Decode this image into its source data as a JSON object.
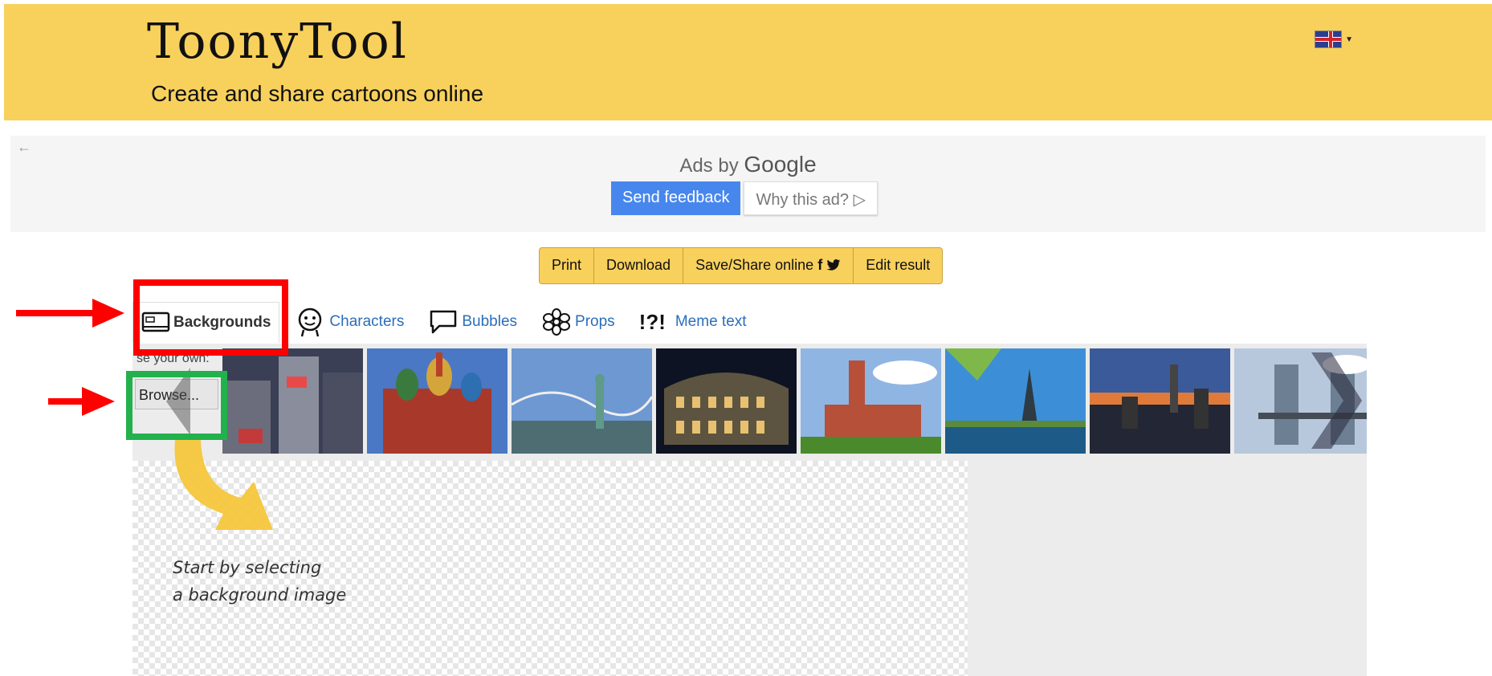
{
  "header": {
    "logo_text": "ToonyTool",
    "tagline": "Create and share cartoons online",
    "language_flag": "uk-flag-icon"
  },
  "ad": {
    "ads_by_prefix": "Ads by",
    "ads_by_brand": "Google",
    "send_feedback": "Send feedback",
    "why_this_ad": "Why this ad?",
    "why_icon": "▷"
  },
  "toolbar": {
    "print": "Print",
    "download": "Download",
    "save_share": "Save/Share online",
    "save_share_icons": "f 🐦",
    "edit_result": "Edit result"
  },
  "tabs": [
    {
      "label": "Backgrounds",
      "icon": "picture-frame-icon",
      "active": true
    },
    {
      "label": "Characters",
      "icon": "character-face-icon",
      "active": false
    },
    {
      "label": "Bubbles",
      "icon": "speech-bubble-icon",
      "active": false
    },
    {
      "label": "Props",
      "icon": "flower-icon",
      "active": false
    },
    {
      "label": "Meme text",
      "icon": "exclamation-icon",
      "active": false
    }
  ],
  "tab_symbols": {
    "meme": "!?!"
  },
  "strip": {
    "own_label": "se your own:",
    "browse_label": "Browse..."
  },
  "thumbnails": [
    {
      "name": "shibuya-city",
      "colors": [
        "#2f3a5a",
        "#8c8d99",
        "#c43a3a"
      ]
    },
    {
      "name": "st-basils-cathedral",
      "colors": [
        "#4a78c4",
        "#b8402a",
        "#3b7a3e"
      ]
    },
    {
      "name": "statue-of-liberty",
      "colors": [
        "#6d98d2",
        "#a9c4dd",
        "#4d6d73"
      ]
    },
    {
      "name": "colosseum-night",
      "colors": [
        "#0d1322",
        "#5c5440",
        "#c8a65f"
      ]
    },
    {
      "name": "belfry-tower",
      "colors": [
        "#8fb5e3",
        "#b65038",
        "#4b8a2c"
      ]
    },
    {
      "name": "eiffel-tower",
      "colors": [
        "#3c8fd6",
        "#7fb84a",
        "#1d5a88"
      ]
    },
    {
      "name": "nyc-skyline-dusk",
      "colors": [
        "#3b5a9a",
        "#e07a3a",
        "#222635"
      ]
    },
    {
      "name": "tower-bridge",
      "colors": [
        "#b8c8dc",
        "#6d7f93",
        "#444c55"
      ]
    }
  ],
  "hint": {
    "line1": "Start by selecting",
    "line2": "a background image"
  },
  "colors": {
    "header_bg": "#f8d05c",
    "link": "#2a6ebb",
    "feedback_btn": "#4787ed",
    "annotation_red": "#ff0000",
    "annotation_green": "#22b14c",
    "annotation_arrow": "#ff0000",
    "hint_arrow": "#f6c63d"
  }
}
